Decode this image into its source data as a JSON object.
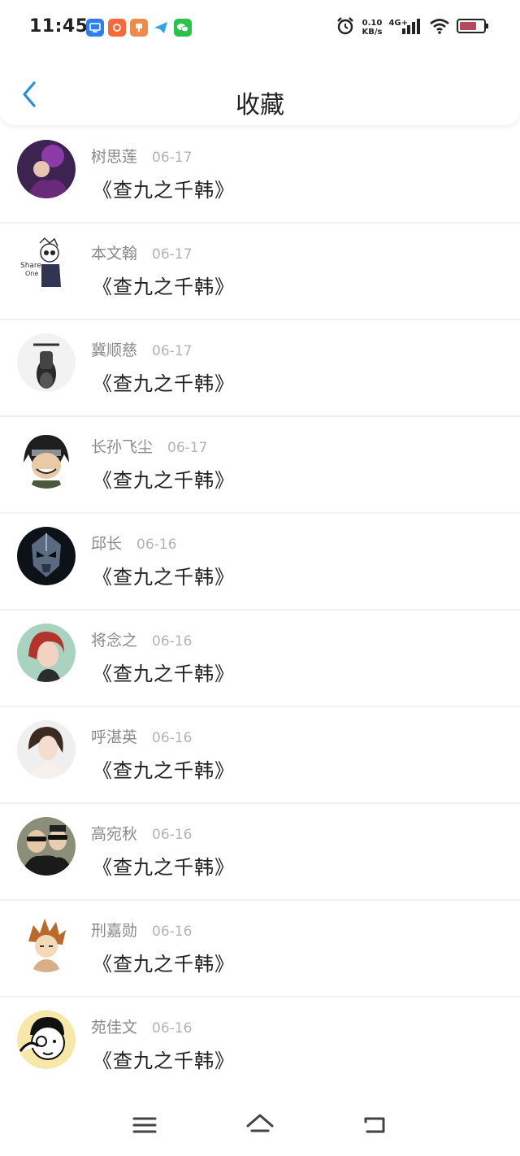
{
  "status_bar": {
    "time": "11:45",
    "net_speed_value": "0.10",
    "net_speed_unit": "KB/s",
    "network_type": "4G+",
    "notification_icons": [
      "screen-cast-icon",
      "app-orange-icon",
      "app-red-icon",
      "paper-plane-icon",
      "wechat-icon"
    ],
    "battery_color": "#b24a5c"
  },
  "header": {
    "title": "收藏",
    "accent_color": "#2a8de0"
  },
  "favorites": [
    {
      "name": "树思莲",
      "date": "06-17",
      "book": "《查九之千韩》"
    },
    {
      "name": "本文翰",
      "date": "06-17",
      "book": "《查九之千韩》"
    },
    {
      "name": "冀顺慈",
      "date": "06-17",
      "book": "《查九之千韩》"
    },
    {
      "name": "长孙飞尘",
      "date": "06-17",
      "book": "《查九之千韩》"
    },
    {
      "name": "邱长",
      "date": "06-16",
      "book": "《查九之千韩》"
    },
    {
      "name": "将念之",
      "date": "06-16",
      "book": "《查九之千韩》"
    },
    {
      "name": "呼湛英",
      "date": "06-16",
      "book": "《查九之千韩》"
    },
    {
      "name": "高宛秋",
      "date": "06-16",
      "book": "《查九之千韩》"
    },
    {
      "name": "刑嘉勋",
      "date": "06-16",
      "book": "《查九之千韩》"
    },
    {
      "name": "苑佳文",
      "date": "06-16",
      "book": "《查九之千韩》"
    }
  ],
  "bottom_nav": [
    "menu-icon",
    "home-icon",
    "back-icon"
  ]
}
